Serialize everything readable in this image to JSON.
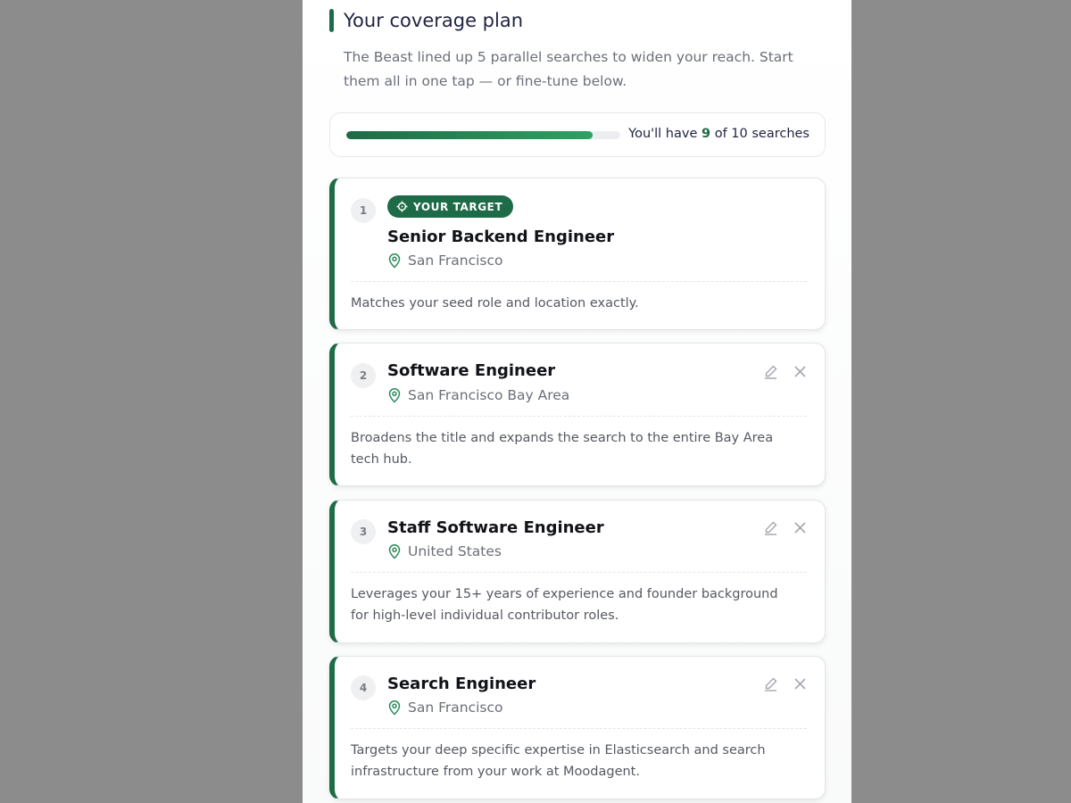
{
  "header": {
    "title": "Your coverage plan",
    "subtitle": "The Beast lined up 5 parallel searches to widen your reach. Start them all in one tap — or fine-tune below."
  },
  "usage": {
    "prefix": "You'll have",
    "count": "9",
    "suffix": "of 10 searches",
    "used": 9,
    "total": 10
  },
  "colors": {
    "accent": "#1e6b47",
    "accent_light": "#2da262",
    "backdrop": "#8c8c8c"
  },
  "cards": [
    {
      "number": "1",
      "badge": "YOUR TARGET",
      "badge_icon": "crosshair-icon",
      "title": "Senior Backend Engineer",
      "location": "San Francisco",
      "description": "Matches your seed role and location exactly."
    },
    {
      "number": "2",
      "title": "Software Engineer",
      "location": "San Francisco Bay Area",
      "description": "Broadens the title and expands the search to the entire Bay Area tech hub."
    },
    {
      "number": "3",
      "title": "Staff Software Engineer",
      "location": "United States",
      "description": "Leverages your 15+ years of experience and founder background for high-level individual contributor roles."
    },
    {
      "number": "4",
      "title": "Search Engineer",
      "location": "San Francisco",
      "description": "Targets your deep specific expertise in Elasticsearch and search infrastructure from your work at Moodagent."
    }
  ],
  "icons": {
    "location": "map-pin-icon",
    "edit": "pencil-icon",
    "remove": "close-icon"
  }
}
